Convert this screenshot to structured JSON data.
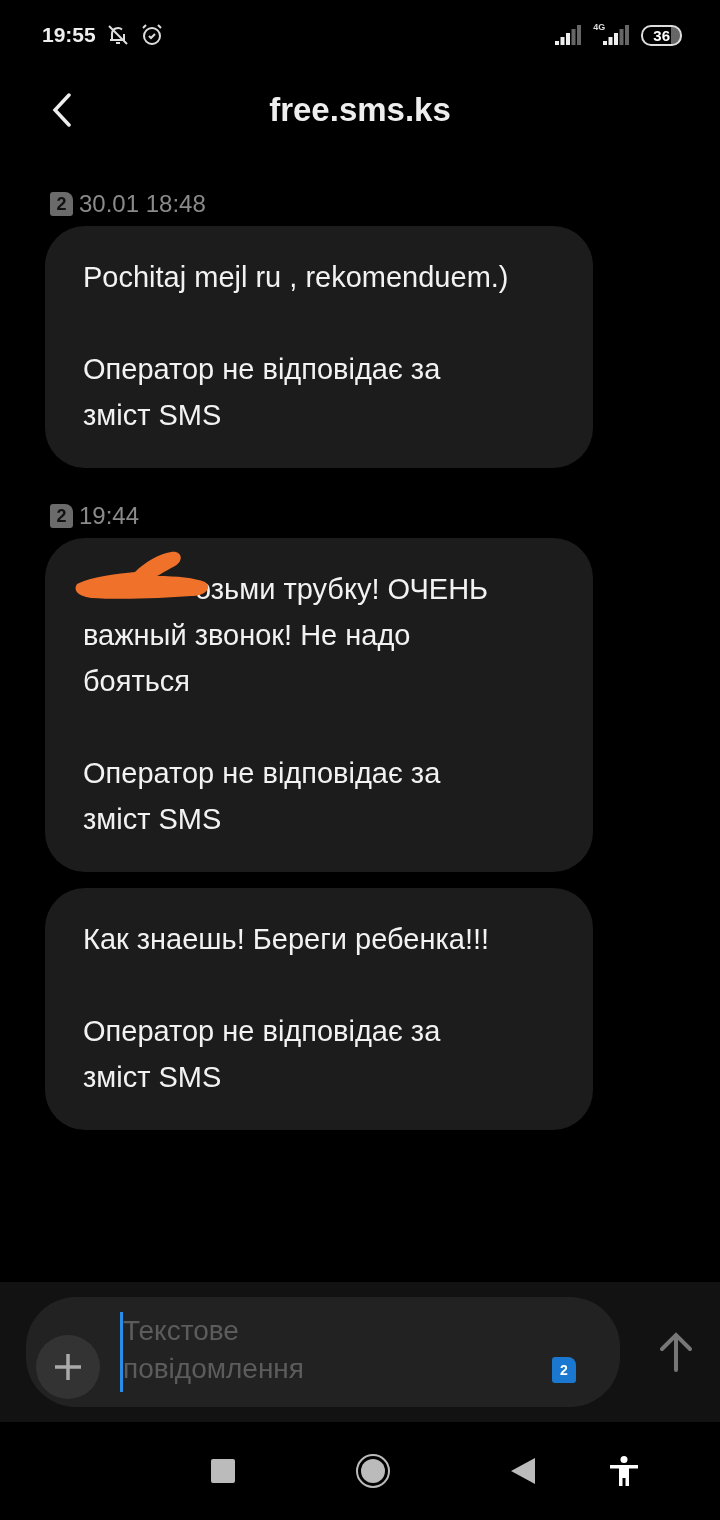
{
  "status_bar": {
    "time": "19:55",
    "network": "4G",
    "battery": "36"
  },
  "header": {
    "title": "free.sms.ks"
  },
  "groups": [
    {
      "sim": "2",
      "time": "30.01 18:48",
      "messages": [
        {
          "redacted": false,
          "text": "Pochitaj mejl ru , rekomenduem.)\n\nОператор не відповідає за зміст SMS"
        }
      ]
    },
    {
      "sim": "2",
      "time": "19:44",
      "messages": [
        {
          "redacted": true,
          "text": "озьми трубку! ОЧЕНЬ важный звонок! Не надо бояться\n\nОператор не відповідає за зміст SMS"
        },
        {
          "redacted": false,
          "text": "Как знаешь! Береги ребенка!!!\n\nОператор не відповідає за зміст SMS"
        }
      ]
    }
  ],
  "composer": {
    "placeholder": "Текстове повідомлення",
    "sim": "2"
  }
}
